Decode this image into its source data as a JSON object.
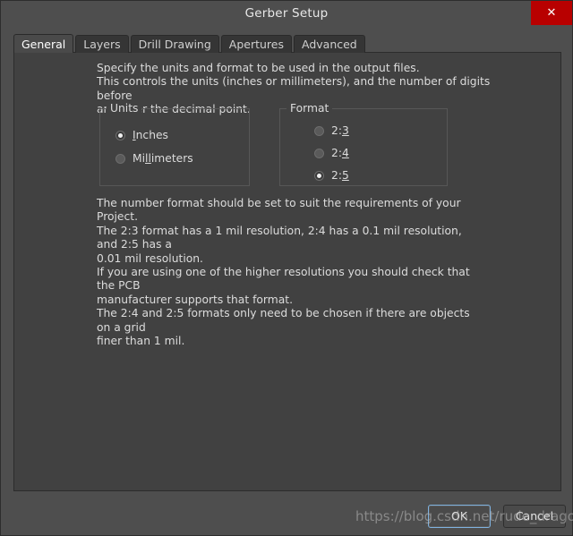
{
  "window": {
    "title": "Gerber Setup",
    "close_icon": "close-icon",
    "close_glyph": "✕",
    "accent_close_color": "#b80000",
    "titlebar_color": "#4e4e4e",
    "panel_color": "#414141"
  },
  "tabs": [
    {
      "label": "General",
      "active": true
    },
    {
      "label": "Layers",
      "active": false
    },
    {
      "label": "Drill Drawing",
      "active": false
    },
    {
      "label": "Apertures",
      "active": false
    },
    {
      "label": "Advanced",
      "active": false
    }
  ],
  "general": {
    "intro_text": "Specify the units and format to be used in the output files.\nThis controls the units (inches or millimeters), and the number of digits before\nand after the decimal point.",
    "units": {
      "title": "Units",
      "options": [
        {
          "label": "Inches",
          "accel": "I",
          "selected": true
        },
        {
          "label": "Millimeters",
          "accel": "ll",
          "selected": false
        }
      ]
    },
    "format": {
      "title": "Format",
      "options": [
        {
          "label": "2:3",
          "accel": "3",
          "selected": false
        },
        {
          "label": "2:4",
          "accel": "4",
          "selected": false
        },
        {
          "label": "2:5",
          "accel": "5",
          "selected": true
        }
      ]
    },
    "notes_text": "The number format should be set to suit the requirements of your Project.\nThe 2:3 format has a 1 mil resolution, 2:4 has a 0.1 mil resolution, and 2:5 has a\n0.01 mil resolution.\nIf you are using one of the higher resolutions you should check that the PCB\nmanufacturer supports that format.\nThe 2:4 and 2:5 formats only need to be chosen if there are objects on a grid\nfiner than 1 mil."
  },
  "footer": {
    "ok_label": "OK",
    "cancel_label": "Cancel",
    "focus_color": "#7fb2e0"
  },
  "watermark": {
    "text": "https://blog.csdn.net/rude_dragon"
  }
}
